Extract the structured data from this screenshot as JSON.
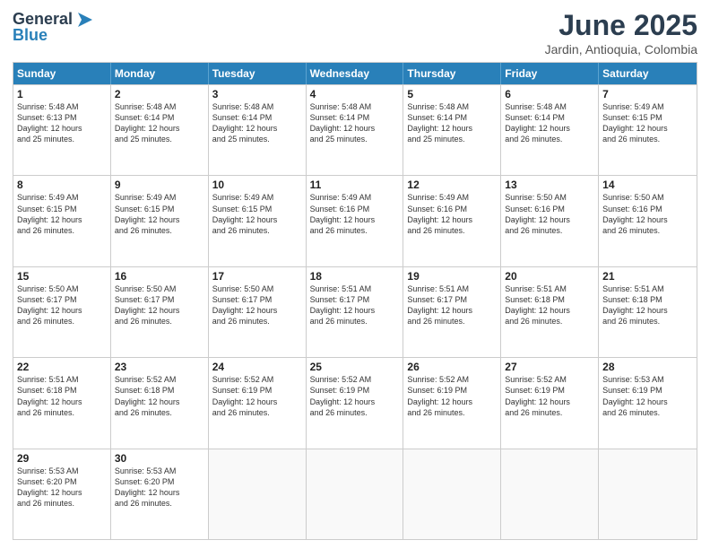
{
  "header": {
    "logo_general": "General",
    "logo_blue": "Blue",
    "title": "June 2025",
    "location": "Jardin, Antioquia, Colombia"
  },
  "days_of_week": [
    "Sunday",
    "Monday",
    "Tuesday",
    "Wednesday",
    "Thursday",
    "Friday",
    "Saturday"
  ],
  "weeks": [
    [
      {
        "day": "1",
        "sunrise": "5:48 AM",
        "sunset": "6:13 PM",
        "daylight": "12 hours and 25 minutes."
      },
      {
        "day": "2",
        "sunrise": "5:48 AM",
        "sunset": "6:14 PM",
        "daylight": "12 hours and 25 minutes."
      },
      {
        "day": "3",
        "sunrise": "5:48 AM",
        "sunset": "6:14 PM",
        "daylight": "12 hours and 25 minutes."
      },
      {
        "day": "4",
        "sunrise": "5:48 AM",
        "sunset": "6:14 PM",
        "daylight": "12 hours and 25 minutes."
      },
      {
        "day": "5",
        "sunrise": "5:48 AM",
        "sunset": "6:14 PM",
        "daylight": "12 hours and 25 minutes."
      },
      {
        "day": "6",
        "sunrise": "5:48 AM",
        "sunset": "6:14 PM",
        "daylight": "12 hours and 26 minutes."
      },
      {
        "day": "7",
        "sunrise": "5:49 AM",
        "sunset": "6:15 PM",
        "daylight": "12 hours and 26 minutes."
      }
    ],
    [
      {
        "day": "8",
        "sunrise": "5:49 AM",
        "sunset": "6:15 PM",
        "daylight": "12 hours and 26 minutes."
      },
      {
        "day": "9",
        "sunrise": "5:49 AM",
        "sunset": "6:15 PM",
        "daylight": "12 hours and 26 minutes."
      },
      {
        "day": "10",
        "sunrise": "5:49 AM",
        "sunset": "6:15 PM",
        "daylight": "12 hours and 26 minutes."
      },
      {
        "day": "11",
        "sunrise": "5:49 AM",
        "sunset": "6:16 PM",
        "daylight": "12 hours and 26 minutes."
      },
      {
        "day": "12",
        "sunrise": "5:49 AM",
        "sunset": "6:16 PM",
        "daylight": "12 hours and 26 minutes."
      },
      {
        "day": "13",
        "sunrise": "5:50 AM",
        "sunset": "6:16 PM",
        "daylight": "12 hours and 26 minutes."
      },
      {
        "day": "14",
        "sunrise": "5:50 AM",
        "sunset": "6:16 PM",
        "daylight": "12 hours and 26 minutes."
      }
    ],
    [
      {
        "day": "15",
        "sunrise": "5:50 AM",
        "sunset": "6:17 PM",
        "daylight": "12 hours and 26 minutes."
      },
      {
        "day": "16",
        "sunrise": "5:50 AM",
        "sunset": "6:17 PM",
        "daylight": "12 hours and 26 minutes."
      },
      {
        "day": "17",
        "sunrise": "5:50 AM",
        "sunset": "6:17 PM",
        "daylight": "12 hours and 26 minutes."
      },
      {
        "day": "18",
        "sunrise": "5:51 AM",
        "sunset": "6:17 PM",
        "daylight": "12 hours and 26 minutes."
      },
      {
        "day": "19",
        "sunrise": "5:51 AM",
        "sunset": "6:17 PM",
        "daylight": "12 hours and 26 minutes."
      },
      {
        "day": "20",
        "sunrise": "5:51 AM",
        "sunset": "6:18 PM",
        "daylight": "12 hours and 26 minutes."
      },
      {
        "day": "21",
        "sunrise": "5:51 AM",
        "sunset": "6:18 PM",
        "daylight": "12 hours and 26 minutes."
      }
    ],
    [
      {
        "day": "22",
        "sunrise": "5:51 AM",
        "sunset": "6:18 PM",
        "daylight": "12 hours and 26 minutes."
      },
      {
        "day": "23",
        "sunrise": "5:52 AM",
        "sunset": "6:18 PM",
        "daylight": "12 hours and 26 minutes."
      },
      {
        "day": "24",
        "sunrise": "5:52 AM",
        "sunset": "6:19 PM",
        "daylight": "12 hours and 26 minutes."
      },
      {
        "day": "25",
        "sunrise": "5:52 AM",
        "sunset": "6:19 PM",
        "daylight": "12 hours and 26 minutes."
      },
      {
        "day": "26",
        "sunrise": "5:52 AM",
        "sunset": "6:19 PM",
        "daylight": "12 hours and 26 minutes."
      },
      {
        "day": "27",
        "sunrise": "5:52 AM",
        "sunset": "6:19 PM",
        "daylight": "12 hours and 26 minutes."
      },
      {
        "day": "28",
        "sunrise": "5:53 AM",
        "sunset": "6:19 PM",
        "daylight": "12 hours and 26 minutes."
      }
    ],
    [
      {
        "day": "29",
        "sunrise": "5:53 AM",
        "sunset": "6:20 PM",
        "daylight": "12 hours and 26 minutes."
      },
      {
        "day": "30",
        "sunrise": "5:53 AM",
        "sunset": "6:20 PM",
        "daylight": "12 hours and 26 minutes."
      },
      {
        "day": "",
        "sunrise": "",
        "sunset": "",
        "daylight": ""
      },
      {
        "day": "",
        "sunrise": "",
        "sunset": "",
        "daylight": ""
      },
      {
        "day": "",
        "sunrise": "",
        "sunset": "",
        "daylight": ""
      },
      {
        "day": "",
        "sunrise": "",
        "sunset": "",
        "daylight": ""
      },
      {
        "day": "",
        "sunrise": "",
        "sunset": "",
        "daylight": ""
      }
    ]
  ],
  "labels": {
    "sunrise": "Sunrise:",
    "sunset": "Sunset:",
    "daylight": "Daylight:"
  }
}
